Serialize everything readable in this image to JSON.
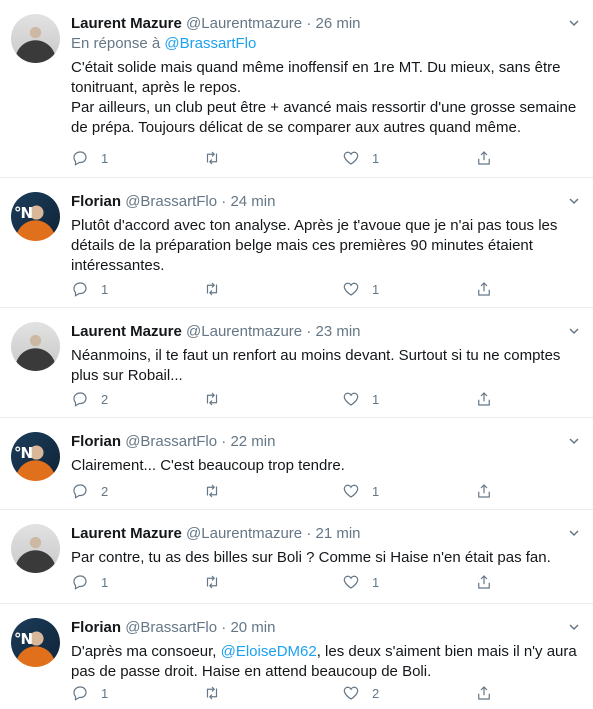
{
  "tweets": [
    {
      "name": "Laurent Mazure",
      "handle": "@Laurentmazure",
      "time": "26 min",
      "reply_prefix": "En réponse à",
      "reply_handle": "@BrassartFlo",
      "lines": [
        "C'était solide mais quand même inoffensif en 1re MT. Du mieux, sans être",
        "tonitruant, après le repos.",
        "Par ailleurs, un club peut être + avancé mais ressortir d'une grosse semaine",
        "de prépa. Toujours délicat de se comparer aux autres quand même."
      ],
      "replies": "1",
      "retweets": "",
      "likes": "1"
    },
    {
      "name": "Florian",
      "handle": "@BrassartFlo",
      "time": "24 min",
      "lines": [
        "Plutôt d'accord avec ton analyse. Après je t'avoue que je n'ai pas tous les",
        "détails de la préparation belge mais ces premières 90 minutes étaient",
        "intéressantes."
      ],
      "replies": "1",
      "retweets": "",
      "likes": "1"
    },
    {
      "name": "Laurent Mazure",
      "handle": "@Laurentmazure",
      "time": "23 min",
      "lines": [
        "Néanmoins, il te faut un renfort au moins devant. Surtout si tu ne comptes",
        "plus sur Robail..."
      ],
      "replies": "2",
      "retweets": "",
      "likes": "1"
    },
    {
      "name": "Florian",
      "handle": "@BrassartFlo",
      "time": "22 min",
      "lines": [
        "Clairement... C'est beaucoup trop tendre."
      ],
      "replies": "2",
      "retweets": "",
      "likes": "1"
    },
    {
      "name": "Laurent Mazure",
      "handle": "@Laurentmazure",
      "time": "21 min",
      "lines": [
        "Par contre, tu as des billes sur Boli ? Comme si Haise n'en était pas fan."
      ],
      "replies": "1",
      "retweets": "",
      "likes": "1"
    },
    {
      "name": "Florian",
      "handle": "@BrassartFlo",
      "time": "20 min",
      "line1_before": "D'après ma consoeur,",
      "line1_mention": "@EloiseDM62",
      "line1_after": ", les deux s'aiment bien mais il n'y aura",
      "line2": "pas de passe droit. Haise en attend beaucoup de Boli.",
      "replies": "1",
      "retweets": "",
      "likes": "2"
    }
  ],
  "dot": "·",
  "avatar_florian_text": "°N",
  "colors": {
    "link": "#1da1f2",
    "muted": "#657786",
    "text": "#14171a",
    "divider": "#e6ecf0"
  },
  "icons": {
    "reply": "speech-bubble",
    "retweet": "retweet-arrows",
    "like": "heart",
    "share": "share-upload",
    "menu": "chevron-down"
  }
}
